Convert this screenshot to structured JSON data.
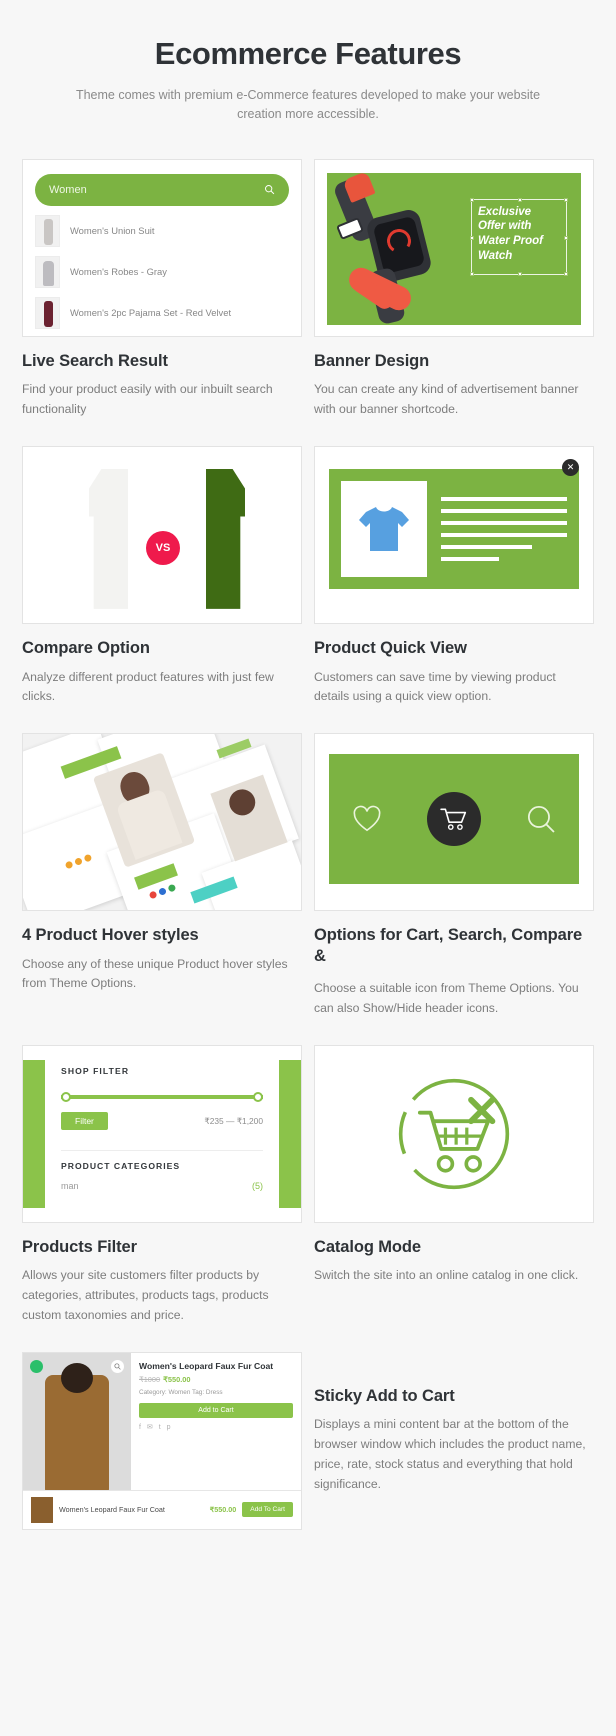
{
  "header": {
    "title": "Ecommerce Features",
    "subtitle": "Theme comes with premium e-Commerce features developed to make your website creation more accessible."
  },
  "colors": {
    "accent_green": "#7cb342",
    "accent_green_light": "#8bc34a",
    "dark": "#2b2b2b",
    "vs_red": "#ef1a4c",
    "page_bg": "#f7f7f7"
  },
  "features": [
    {
      "title": "Live Search Result",
      "description": "Find your product easily with our inbuilt search functionality"
    },
    {
      "title": "Banner Design",
      "description": "You can create any kind of advertisement banner with our banner shortcode."
    },
    {
      "title": "Compare Option",
      "description": "Analyze different product features with just few clicks."
    },
    {
      "title": "Product Quick View",
      "description": "Customers can save time by viewing product details using a quick view option."
    },
    {
      "title": "4 Product Hover styles",
      "description": "Choose any of these unique Product hover styles from Theme Options."
    },
    {
      "title": "Options for Cart, Search, Compare &",
      "description": "Choose a suitable icon from Theme Options. You can also Show/Hide header icons."
    },
    {
      "title": "Products Filter",
      "description": "Allows your site customers filter products by categories, attributes, products tags, products custom taxonomies and price."
    },
    {
      "title": "Catalog Mode",
      "description": "Switch the site into an online catalog in one click."
    },
    {
      "title": "Sticky Add to Cart",
      "description": "Displays a mini content bar at the bottom of the browser window which includes the product name, price, rate, stock status and everything that hold significance."
    }
  ],
  "live_search": {
    "query": "Women",
    "search_icon": "search-icon",
    "results": [
      "Women's Union Suit",
      "Women's Robes - Gray",
      "Women's 2pc Pajama Set - Red Velvet"
    ]
  },
  "banner": {
    "text": "Exclusive Offer with Water Proof Watch"
  },
  "compare": {
    "badge": "VS"
  },
  "quick_view": {
    "close_icon": "close-icon",
    "product_icon": "tshirt-icon"
  },
  "cart_options": {
    "icons": [
      "heart-icon",
      "cart-icon",
      "search-icon"
    ]
  },
  "shop_filter": {
    "heading": "SHOP FILTER",
    "filter_button": "Filter",
    "price_range": "₹235 — ₹1,200",
    "categories_heading": "PRODUCT CATEGORIES",
    "category_name": "man",
    "category_count": "(5)"
  },
  "catalog": {
    "icon": "cart-crossed-icon"
  },
  "sticky_cart": {
    "product_title": "Women's Leopard Faux Fur Coat",
    "price_old": "₹1000",
    "price_new": "₹550.00",
    "meta": "Category: Women\nTag: Dress",
    "cta": "Add to Cart",
    "social": "f  ✉  t  p",
    "bar_product": "Women's Leopard Faux Fur Coat",
    "bar_price": "₹550.00",
    "bar_button": "Add To Cart",
    "search_icon": "search-icon"
  }
}
